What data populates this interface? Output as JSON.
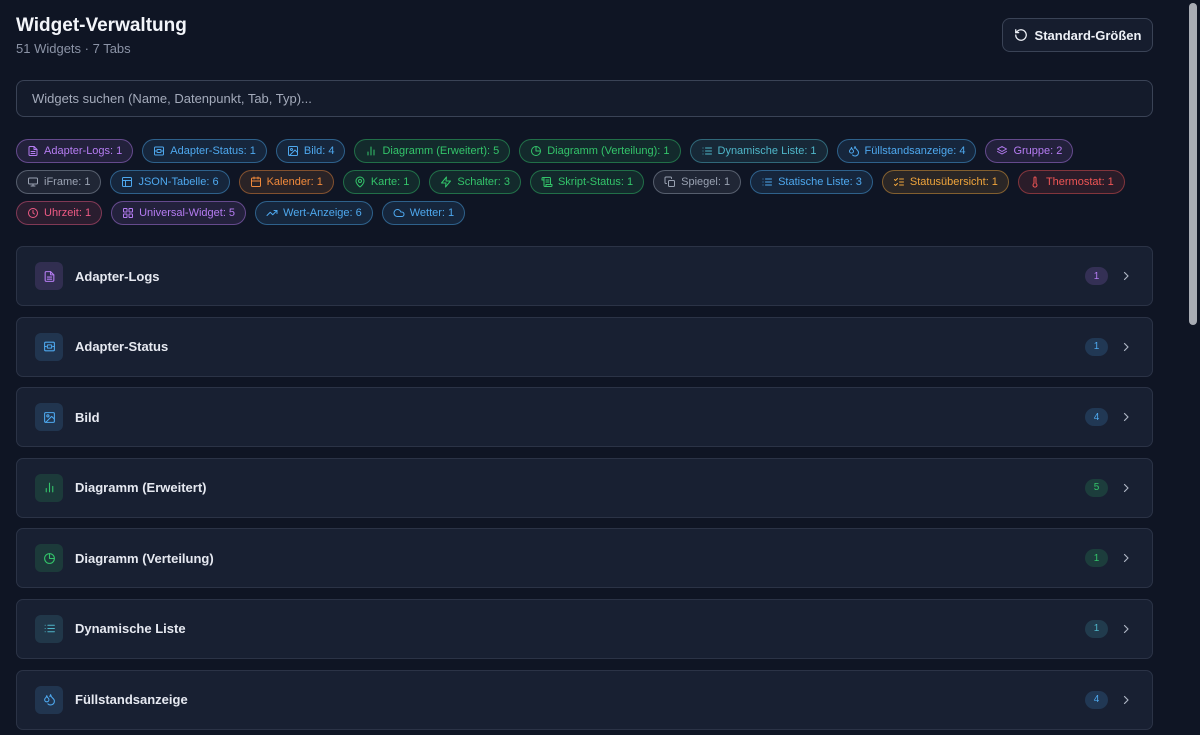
{
  "header": {
    "title": "Widget-Verwaltung",
    "subtitle": "51 Widgets · 7 Tabs",
    "reset_label": "Standard-Größen",
    "reset_icon": "rotate-ccw-icon"
  },
  "search": {
    "placeholder": "Widgets suchen (Name, Datenpunkt, Tab, Typ)..."
  },
  "chips": [
    [
      {
        "label": "Adapter-Logs: 1",
        "icon": "file-text-icon",
        "color": "#b57cf2"
      },
      {
        "label": "Adapter-Status: 1",
        "icon": "server-icon",
        "color": "#4ea8ee"
      },
      {
        "label": "Bild: 4",
        "icon": "image-icon",
        "color": "#4ea8ee"
      },
      {
        "label": "Diagramm (Erweitert): 5",
        "icon": "bar-chart-icon",
        "color": "#33c46a"
      },
      {
        "label": "Diagramm (Verteilung): 1",
        "icon": "pie-chart-icon",
        "color": "#33c46a"
      },
      {
        "label": "Dynamische Liste: 1",
        "icon": "list-icon",
        "color": "#4fb6c9"
      },
      {
        "label": "Füllstandsanzeige: 4",
        "icon": "droplets-icon",
        "color": "#4ea8ee"
      },
      {
        "label": "Gruppe: 2",
        "icon": "layers-icon",
        "color": "#b57cf2"
      }
    ],
    [
      {
        "label": "iFrame: 1",
        "icon": "monitor-icon",
        "color": "#9aa2b2"
      },
      {
        "label": "JSON-Tabelle: 6",
        "icon": "table-icon",
        "color": "#4ea8ee"
      },
      {
        "label": "Kalender: 1",
        "icon": "calendar-icon",
        "color": "#f08a3c"
      },
      {
        "label": "Karte: 1",
        "icon": "map-pin-icon",
        "color": "#33c46a"
      },
      {
        "label": "Schalter: 3",
        "icon": "zap-icon",
        "color": "#33c46a"
      },
      {
        "label": "Skript-Status: 1",
        "icon": "scroll-icon",
        "color": "#33c46a"
      },
      {
        "label": "Spiegel: 1",
        "icon": "copy-icon",
        "color": "#9aa2b2"
      },
      {
        "label": "Statische Liste: 3",
        "icon": "list-icon",
        "color": "#4ea8ee"
      },
      {
        "label": "Statusübersicht: 1",
        "icon": "list-checks-icon",
        "color": "#f0a53c"
      },
      {
        "label": "Thermostat: 1",
        "icon": "thermometer-icon",
        "color": "#ef5555"
      }
    ],
    [
      {
        "label": "Uhrzeit: 1",
        "icon": "clock-icon",
        "color": "#ee5a84"
      },
      {
        "label": "Universal-Widget: 5",
        "icon": "grid-icon",
        "color": "#b57cf2"
      },
      {
        "label": "Wert-Anzeige: 6",
        "icon": "trending-up-icon",
        "color": "#4ea8ee"
      },
      {
        "label": "Wetter: 1",
        "icon": "cloud-icon",
        "color": "#4ea8ee"
      }
    ]
  ],
  "groups": [
    {
      "label": "Adapter-Logs",
      "count": "1",
      "icon": "file-text-icon",
      "color": "#b57cf2"
    },
    {
      "label": "Adapter-Status",
      "count": "1",
      "icon": "server-icon",
      "color": "#4ea8ee"
    },
    {
      "label": "Bild",
      "count": "4",
      "icon": "image-icon",
      "color": "#4ea8ee"
    },
    {
      "label": "Diagramm (Erweitert)",
      "count": "5",
      "icon": "bar-chart-icon",
      "color": "#33c46a"
    },
    {
      "label": "Diagramm (Verteilung)",
      "count": "1",
      "icon": "pie-chart-icon",
      "color": "#33c46a"
    },
    {
      "label": "Dynamische Liste",
      "count": "1",
      "icon": "list-icon",
      "color": "#4fb6c9"
    },
    {
      "label": "Füllstandsanzeige",
      "count": "4",
      "icon": "droplets-icon",
      "color": "#4ea8ee"
    }
  ]
}
